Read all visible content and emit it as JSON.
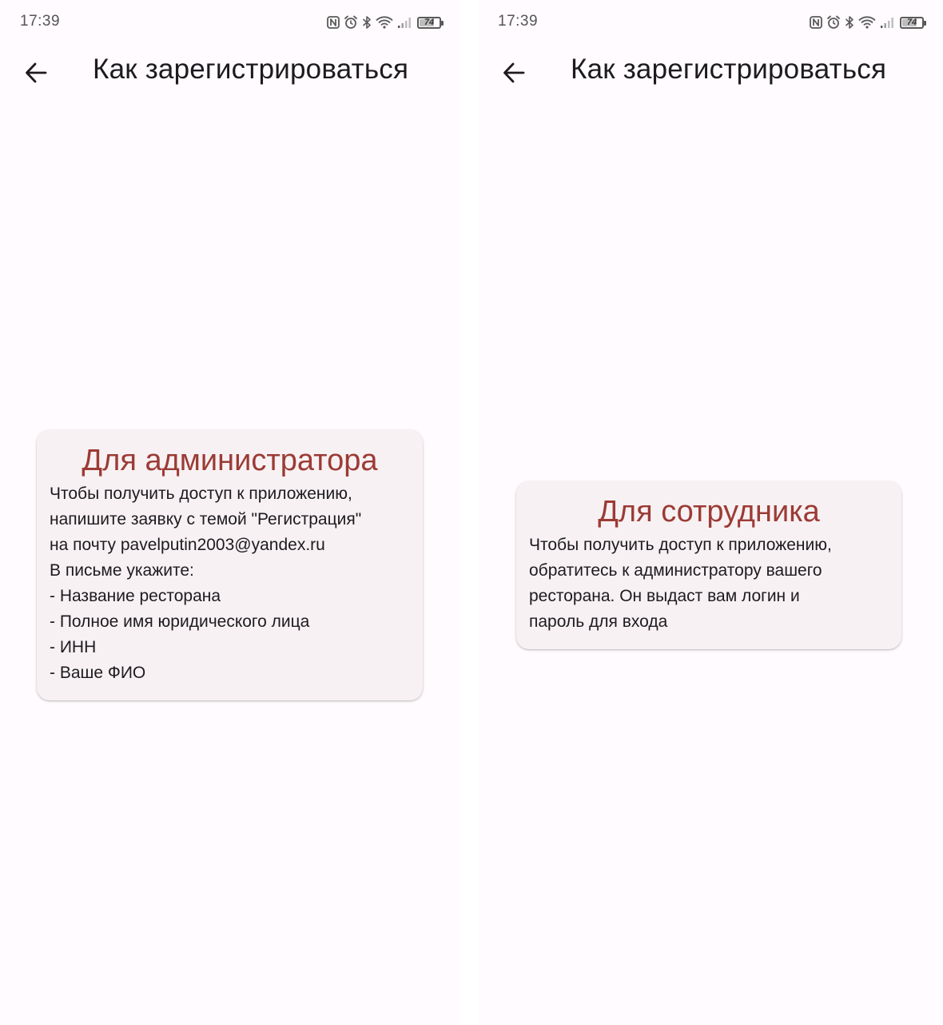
{
  "screens": [
    {
      "status_bar": {
        "time": "17:39",
        "icons": [
          "nfc-icon",
          "alarm-icon",
          "bluetooth-icon",
          "wifi-icon",
          "signal-icon",
          "battery-icon"
        ],
        "battery_level": "74",
        "battery_fraction": 0.74
      },
      "app_bar": {
        "back_icon": "arrow-back-icon",
        "title": "Как зарегистрироваться"
      },
      "card": {
        "title": "Для администратора",
        "lines": [
          "Чтобы получить доступ к приложению,",
          "напишите заявку с темой \"Регистрация\"",
          "на почту pavelputin2003@yandex.ru",
          "В письме укажите:",
          "- Название ресторана",
          "- Полное имя юридического лица",
          "- ИНН",
          "- Ваше ФИО"
        ]
      }
    },
    {
      "status_bar": {
        "time": "17:39",
        "icons": [
          "nfc-icon",
          "alarm-icon",
          "bluetooth-icon",
          "wifi-icon",
          "signal-icon",
          "battery-icon"
        ],
        "battery_level": "74",
        "battery_fraction": 0.74
      },
      "app_bar": {
        "back_icon": "arrow-back-icon",
        "title": "Как зарегистрироваться"
      },
      "card": {
        "title": "Для сотрудника",
        "lines": [
          "Чтобы получить доступ к приложению,",
          "обратитесь к администратору вашего",
          "ресторана. Он выдаст вам логин и",
          "пароль для входа"
        ]
      }
    }
  ],
  "colors": {
    "background": "#fffbfe",
    "card_background": "#f7f1f3",
    "card_title": "#9c3b35",
    "text": "#1d1b20",
    "status_text": "#555555"
  }
}
